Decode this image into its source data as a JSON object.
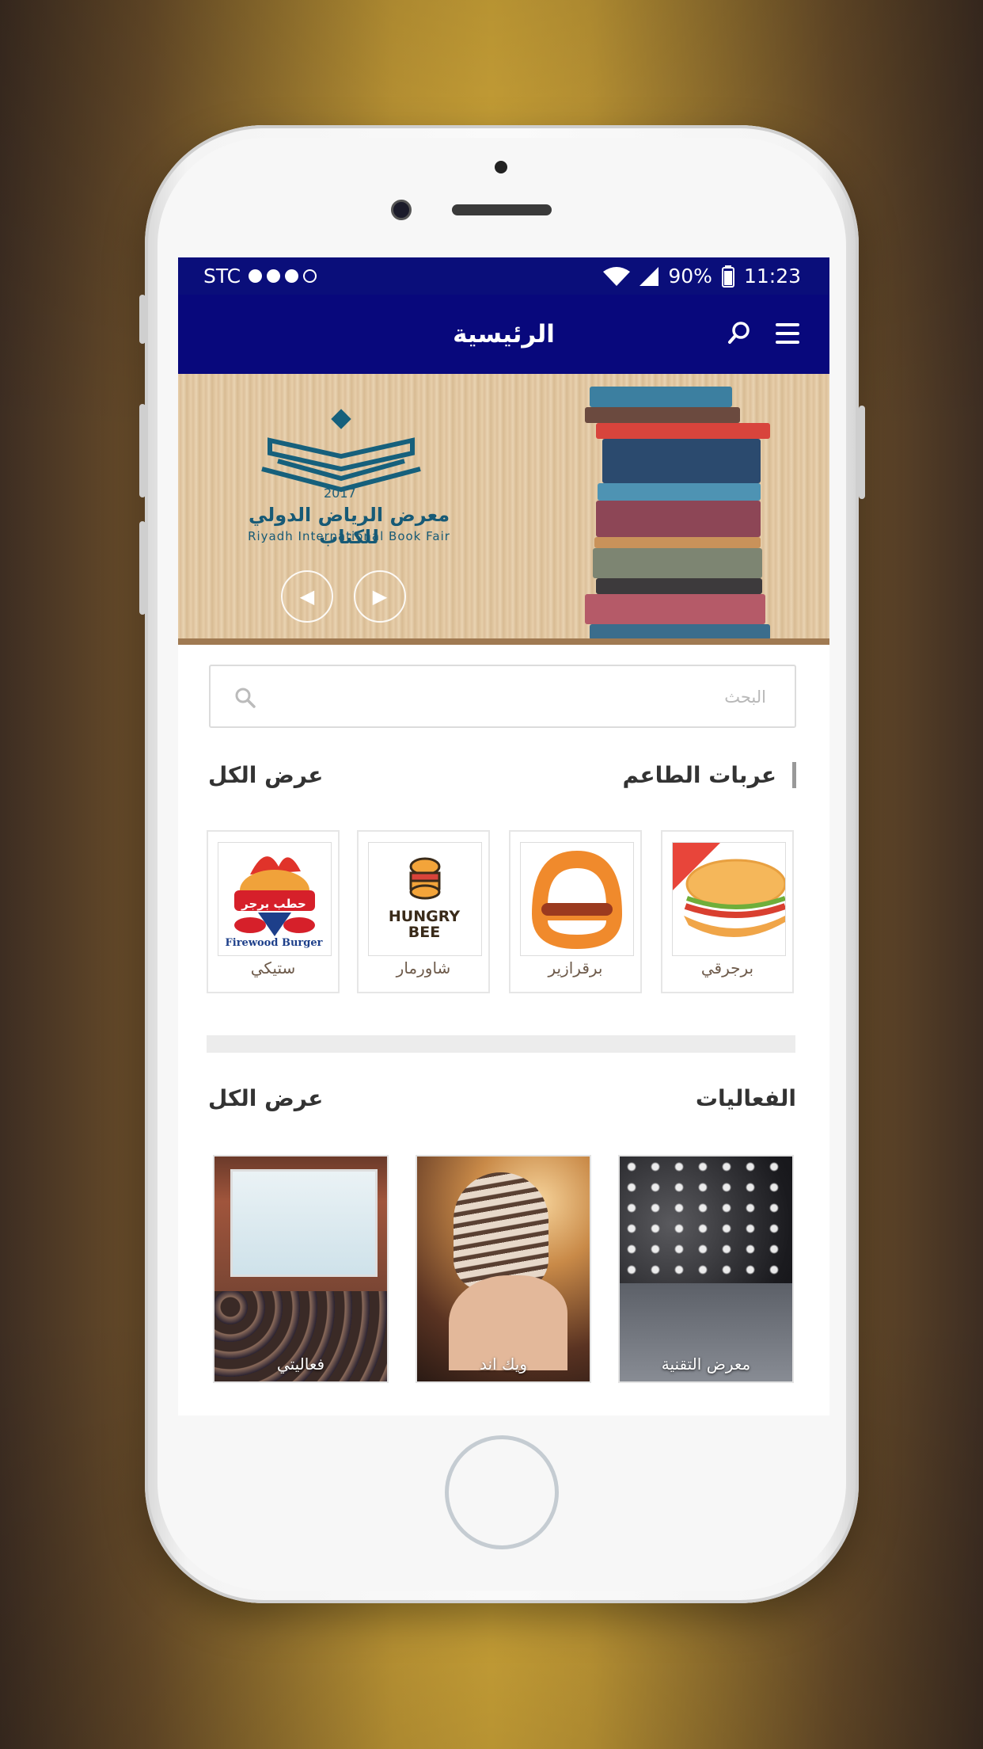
{
  "status_bar": {
    "carrier": "STC",
    "battery": "90%",
    "time": "11:23"
  },
  "header": {
    "title": "الرئيسية",
    "menu_icon": "hamburger-icon",
    "search_icon": "search-icon"
  },
  "banner": {
    "logo_year": "2017",
    "logo_arabic": "معرض الرياض الدولي للكتاب",
    "logo_english": "Riyadh International Book Fair",
    "prev_icon": "arrow-left-icon",
    "next_icon": "arrow-right-icon"
  },
  "search": {
    "placeholder": "البحث"
  },
  "food_trucks": {
    "title": "عربات الطاعم",
    "view_all": "عرض الكل",
    "items": [
      {
        "label": "برجرقي"
      },
      {
        "label": "برقرازير"
      },
      {
        "label": "شاورمار",
        "logo_text_1": "HUNGRY",
        "logo_text_2": "BEE"
      },
      {
        "label": "ستيكي",
        "logo_text_1": "حطب برجر",
        "logo_text_2": "Firewood Burger"
      }
    ]
  },
  "events": {
    "title": "الفعاليات",
    "view_all": "عرض الكل",
    "items": [
      {
        "label": "معرض التقنية"
      },
      {
        "label": "ويك اند"
      },
      {
        "label": "فعاليتي"
      }
    ]
  },
  "colors": {
    "header_bg": "#08087c",
    "statusbar_bg": "#0a0e7a"
  }
}
